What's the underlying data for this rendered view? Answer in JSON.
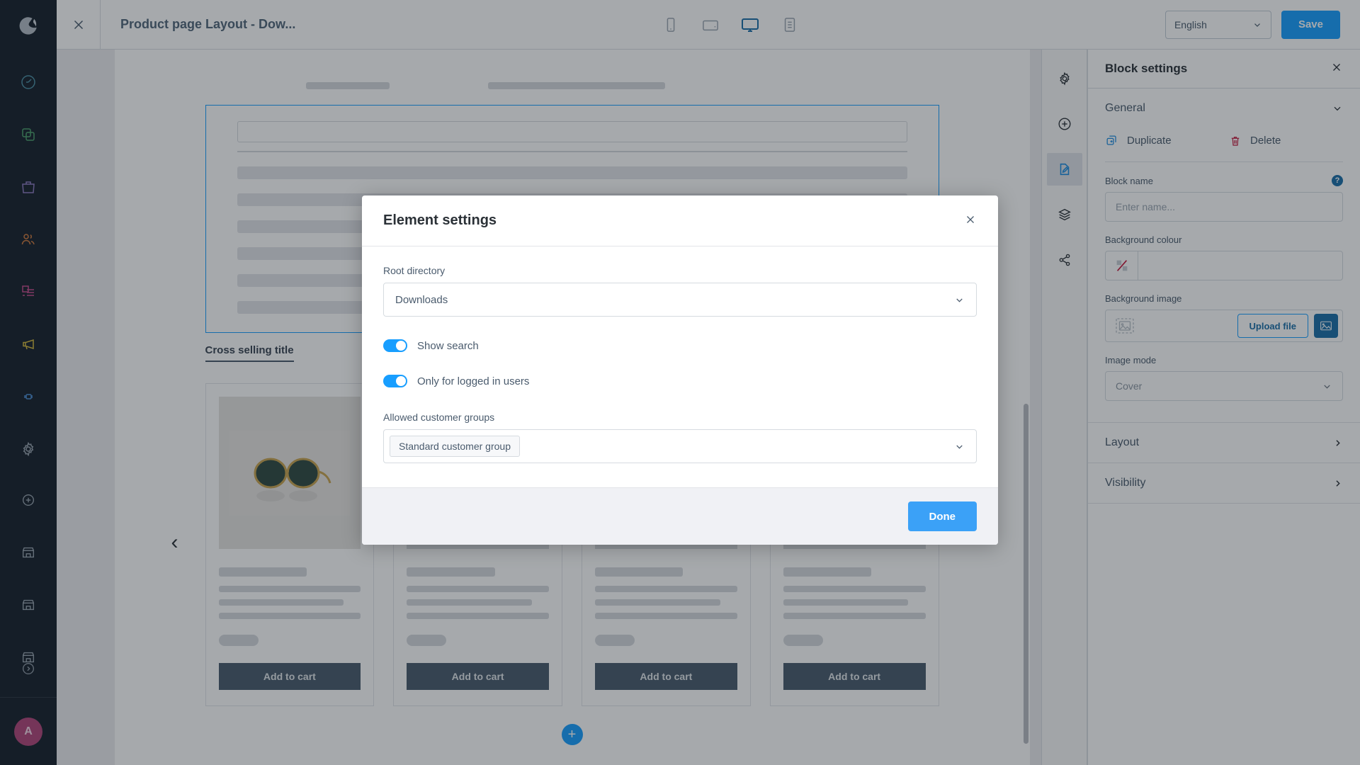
{
  "app": {
    "brand_icon": "shopware-logo-icon"
  },
  "topbar": {
    "close_icon": "close-icon",
    "title": "Product page Layout - Dow...",
    "devices": [
      {
        "name": "mobile-view-button",
        "icon": "mobile-icon",
        "active": false
      },
      {
        "name": "tablet-view-button",
        "icon": "tablet-icon",
        "active": false
      },
      {
        "name": "desktop-view-button",
        "icon": "desktop-icon",
        "active": true
      },
      {
        "name": "form-view-button",
        "icon": "form-icon",
        "active": false
      }
    ],
    "language": "English",
    "save_label": "Save",
    "accent": "#189eff"
  },
  "leftnav": {
    "items": [
      {
        "name": "sidebar-item-dashboard",
        "icon": "dashboard-icon",
        "color": "#4b8fa3"
      },
      {
        "name": "sidebar-item-catalogues",
        "icon": "catalogue-icon",
        "color": "#4b9e6b"
      },
      {
        "name": "sidebar-item-orders",
        "icon": "orders-bag-icon",
        "color": "#8d7ac0"
      },
      {
        "name": "sidebar-item-customers",
        "icon": "customers-icon",
        "color": "#d07a3c"
      },
      {
        "name": "sidebar-item-content",
        "icon": "content-icon",
        "color": "#c44b8c"
      },
      {
        "name": "sidebar-item-marketing",
        "icon": "megaphone-icon",
        "color": "#d6b93c"
      },
      {
        "name": "sidebar-item-extensions",
        "icon": "plug-icon",
        "color": "#4b8fd6"
      },
      {
        "name": "sidebar-item-settings",
        "icon": "gear-icon",
        "color": "#98a3ae"
      }
    ],
    "tools": [
      {
        "name": "sidebar-item-add",
        "icon": "plus-circle-icon",
        "color": "#98a3ae"
      },
      {
        "name": "sidebar-item-store-1",
        "icon": "store-icon",
        "color": "#98a3ae"
      },
      {
        "name": "sidebar-item-store-2",
        "icon": "store-icon",
        "color": "#98a3ae"
      },
      {
        "name": "sidebar-item-store-3",
        "icon": "store-icon",
        "color": "#98a3ae"
      },
      {
        "name": "sidebar-item-more",
        "icon": "kebab-menu-icon",
        "color": "#98a3ae"
      }
    ],
    "expand_icon": "chevron-right-circle-icon",
    "avatar_initial": "A",
    "avatar_color": "#b0457a"
  },
  "stage": {
    "cross_selling_title": "Cross selling title",
    "prev_arrow_icon": "chevron-left-icon",
    "add_block_icon": "plus-circle-icon",
    "product_cards": [
      {
        "name": "product-card",
        "add_to_cart": "Add to cart",
        "has_image": true
      },
      {
        "name": "product-card",
        "add_to_cart": "Add to cart",
        "has_image": false
      },
      {
        "name": "product-card",
        "add_to_cart": "Add to cart",
        "has_image": false
      },
      {
        "name": "product-card",
        "add_to_cart": "Add to cart",
        "has_image": false
      }
    ]
  },
  "iconrail": {
    "items": [
      {
        "name": "rail-settings-button",
        "icon": "gear-icon",
        "active": false
      },
      {
        "name": "rail-add-block-button",
        "icon": "plus-circle-icon",
        "active": false
      },
      {
        "name": "rail-edit-block-button",
        "icon": "edit-document-icon",
        "active": true
      },
      {
        "name": "rail-layers-button",
        "icon": "layers-icon",
        "active": false
      },
      {
        "name": "rail-share-button",
        "icon": "share-icon",
        "active": false
      }
    ]
  },
  "sidebar": {
    "title": "Block settings",
    "close_icon": "close-icon",
    "general": {
      "label": "General",
      "chevron_icon": "chevron-down-icon",
      "duplicate_label": "Duplicate",
      "duplicate_icon": "duplicate-icon",
      "delete_label": "Delete",
      "delete_icon": "trash-icon",
      "block_name_label": "Block name",
      "block_name_help_icon": "help-icon",
      "block_name_placeholder": "Enter name...",
      "block_name_value": "",
      "background_colour_label": "Background colour",
      "background_colour_value": "",
      "background_colour_swatch_icon": "no-colour-icon",
      "background_image_label": "Background image",
      "background_image_placeholder_icon": "image-placeholder-icon",
      "upload_label": "Upload file",
      "media_picker_icon": "image-picker-icon",
      "image_mode_label": "Image mode",
      "image_mode_value": "Cover",
      "image_mode_chevron_icon": "chevron-down-icon"
    },
    "accordions": [
      {
        "name": "sidebar-accordion-layout",
        "label": "Layout",
        "icon": "chevron-right-icon"
      },
      {
        "name": "sidebar-accordion-visibility",
        "label": "Visibility",
        "icon": "chevron-right-icon"
      }
    ]
  },
  "modal": {
    "title": "Element settings",
    "close_icon": "close-icon",
    "root_directory_label": "Root directory",
    "root_directory_value": "Downloads",
    "root_directory_chevron_icon": "chevron-down-icon",
    "show_search_label": "Show search",
    "show_search_on": true,
    "only_logged_in_label": "Only for logged in users",
    "only_logged_in_on": true,
    "allowed_groups_label": "Allowed customer groups",
    "allowed_groups_tags": [
      "Standard customer group"
    ],
    "allowed_groups_chevron_icon": "chevron-down-icon",
    "done_label": "Done",
    "done_color": "#3ba1f7"
  }
}
